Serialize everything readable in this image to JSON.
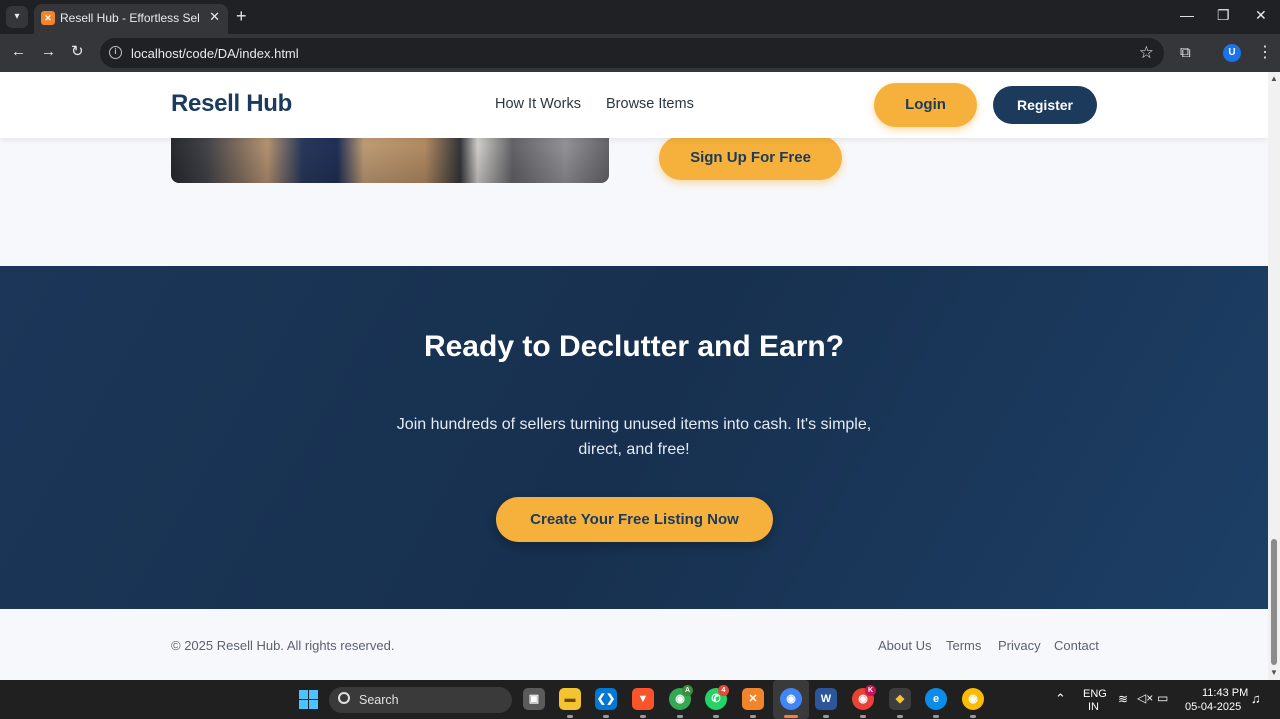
{
  "browser": {
    "tab_title": "Resell Hub - Effortless Selling, D",
    "tab_close": "✕",
    "new_tab": "+",
    "url": "localhost/code/DA/index.html",
    "profile_initial": "U"
  },
  "header": {
    "logo": "Resell Hub",
    "nav": [
      "How It Works",
      "Browse Items"
    ],
    "login": "Login",
    "register": "Register"
  },
  "hero": {
    "signup": "Sign Up For Free"
  },
  "cta": {
    "title": "Ready to Declutter and Earn?",
    "text": "Join hundreds of sellers turning unused items into cash. It's simple, direct, and free!",
    "button": "Create Your Free Listing Now"
  },
  "footer": {
    "copyright": "© 2025 Resell Hub. All rights reserved.",
    "links": [
      "About Us",
      "Terms",
      "Privacy",
      "Contact"
    ]
  },
  "taskbar": {
    "search_label": "Search",
    "lang_top": "ENG",
    "lang_bottom": "IN",
    "time": "11:43 PM",
    "date": "05-04-2025",
    "badges": {
      "whatsapp": "4",
      "chrome_profile": "A",
      "chrome_k": "K"
    }
  },
  "colors": {
    "brand_navy": "#1b3a5c",
    "accent_orange": "#f6b13d",
    "cta_background": "#17304f"
  }
}
